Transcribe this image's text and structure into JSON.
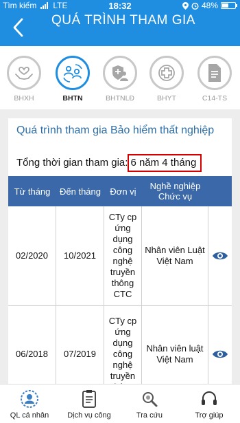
{
  "status": {
    "carrier": "Tìm kiếm",
    "network": "LTE",
    "time": "18:32",
    "battery": "48%"
  },
  "header": {
    "title": "QUÁ TRÌNH THAM GIA"
  },
  "categories": [
    {
      "label": "BHXH",
      "icon": "heart-hands-icon"
    },
    {
      "label": "BHTN",
      "icon": "people-exchange-icon",
      "active": true
    },
    {
      "label": "BHTNLĐ",
      "icon": "shield-person-icon"
    },
    {
      "label": "BHYT",
      "icon": "medical-cross-icon"
    },
    {
      "label": "C14-TS",
      "icon": "document-icon"
    }
  ],
  "card": {
    "title": "Quá trình tham gia Bảo hiểm thất nghiệp",
    "total_label": "Tổng thời gian tham gia:",
    "total_value": "6 năm 4 tháng"
  },
  "table": {
    "headers": [
      "Từ tháng",
      "Đến tháng",
      "Đơn vị",
      "Nghề nghiệp Chức vụ"
    ],
    "rows": [
      {
        "from": "02/2020",
        "to": "10/2021",
        "unit": "CTy cp ứng dụng công nghệ truyền thông CTC",
        "job": "Nhân viên Luật Việt Nam"
      },
      {
        "from": "06/2018",
        "to": "07/2019",
        "unit": "CTy cp ứng dụng công nghệ truyền thông",
        "job": "Nhân viên luật Việt Nam"
      }
    ]
  },
  "bottom_nav": [
    {
      "label": "QL cá nhân",
      "icon": "person-profile-icon",
      "active": true
    },
    {
      "label": "Dịch vụ công",
      "icon": "clipboard-icon"
    },
    {
      "label": "Tra cứu",
      "icon": "magnifier-icon"
    },
    {
      "label": "Trợ giúp",
      "icon": "headset-icon"
    }
  ],
  "colors": {
    "primary": "#1f8ee0",
    "table_header": "#3a68a8",
    "highlight": "#d40000"
  }
}
